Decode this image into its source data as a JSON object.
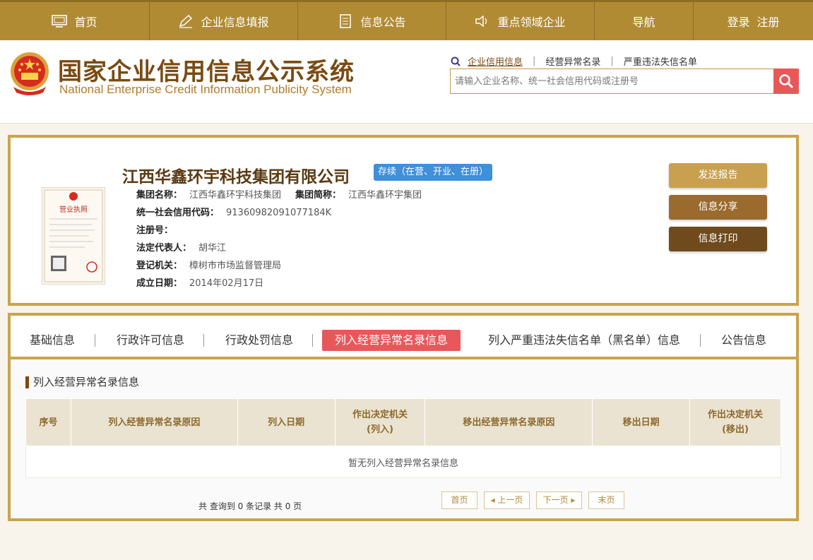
{
  "nav": {
    "home": "首页",
    "fill_info": "企业信息填报",
    "announcement": "信息公告",
    "key_enterprise": "重点领域企业",
    "guide": "导航",
    "login": "登录",
    "register": "注册"
  },
  "header": {
    "title_cn": "国家企业信用信息公示系统",
    "title_en": "National Enterprise Credit Information Publicity System",
    "links": [
      "企业信用信息",
      "经营异常名录",
      "严重违法失信名单"
    ],
    "search_placeholder": "请输入企业名称、统一社会信用代码或注册号"
  },
  "company": {
    "name": "江西华鑫环宇科技集团有限公司",
    "status": "存续（在营、开业、在册）",
    "license_title": "营业执照",
    "fields": {
      "group_name_label": "集团名称：",
      "group_name": "江西华鑫环宇科技集团",
      "group_short_label": "集团简称：",
      "group_short": "江西华鑫环宇集团",
      "credit_code_label": "统一社会信用代码：",
      "credit_code": "91360982091077184K",
      "reg_no_label": "注册号：",
      "reg_no": "",
      "legal_rep_label": "法定代表人：",
      "legal_rep": "胡华江",
      "reg_authority_label": "登记机关：",
      "reg_authority": "樟树市市场监督管理局",
      "est_date_label": "成立日期：",
      "est_date": "2014年02月17日"
    },
    "actions": [
      "发送报告",
      "信息分享",
      "信息打印"
    ]
  },
  "tabs": [
    "基础信息",
    "行政许可信息",
    "行政处罚信息",
    "列入经营异常名录信息",
    "列入严重违法失信名单（黑名单）信息",
    "公告信息"
  ],
  "section": {
    "title": "列入经营异常名录信息",
    "columns": [
      "序号",
      "列入经营异常名录原因",
      "列入日期",
      "作出决定机关\n(列入)",
      "移出经营异常名录原因",
      "移出日期",
      "作出决定机关\n(移出)"
    ],
    "empty_text": "暂无列入经营异常名录信息"
  },
  "pager": {
    "summary": "共 查询到 0 条记录 共 0 页",
    "first": "首页",
    "prev": "上一页",
    "next": "下一页",
    "last": "末页"
  },
  "colors": {
    "nav_bg": "#b18b34",
    "panel_border": "#c9a44c",
    "accent_red": "#e8585a",
    "status_blue": "#3f8fd9",
    "btn_send": "#c9a04f",
    "btn_share": "#9a6a2e",
    "btn_print": "#6e4a1c"
  }
}
